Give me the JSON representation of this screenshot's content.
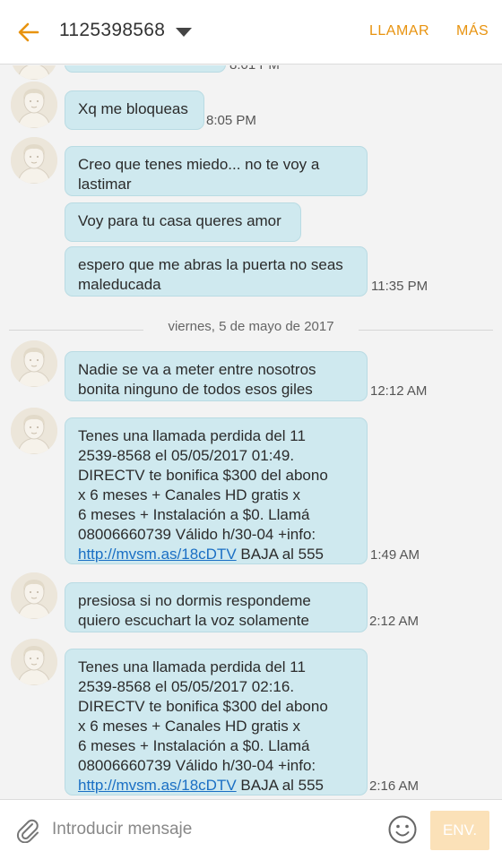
{
  "header": {
    "title": "1125398568",
    "call_label": "LLAMAR",
    "more_label": "MÁS"
  },
  "conversation": {
    "partial_time": "8:01 PM",
    "date_separator": "viernes, 5 de mayo de 2017",
    "messages": [
      {
        "text": "Xq me bloqueas",
        "time": "8:05 PM"
      },
      {
        "text": "Creo que tenes miedo... no te voy a\nlastimar",
        "time": ""
      },
      {
        "text": "Voy para tu casa queres amor",
        "time": ""
      },
      {
        "text": "espero que me abras la puerta no seas\nmaleducada",
        "time": "11:35 PM"
      },
      {
        "text": "Nadie se va a meter entre nosotros\nbonita ninguno de todos esos giles",
        "time": "12:12 AM"
      },
      {
        "text": "Tenes una llamada perdida del 11\n2539-8568 el 05/05/2017 01:49.\nDIRECTV te bonifica $300 del abono\nx 6 meses + Canales HD gratis x\n6 meses + Instalación a $0. Llamá\n08006660739 Válido h/30-04 +info:\n",
        "link": "http://mvsm.as/18cDTV",
        "suffix": " BAJA al 555",
        "time": "1:49 AM"
      },
      {
        "text": "presiosa si no dormis respondeme\nquiero escuchart la voz solamente",
        "time": "2:12 AM"
      },
      {
        "text": "Tenes una llamada perdida del 11\n2539-8568 el 05/05/2017 02:16.\nDIRECTV te bonifica $300 del abono\nx 6 meses + Canales HD gratis x\n6 meses + Instalación a $0. Llamá\n08006660739 Válido h/30-04 +info:\n",
        "link": "http://mvsm.as/18cDTV",
        "suffix": " BAJA al 555",
        "time": "2:16 AM"
      }
    ]
  },
  "input": {
    "placeholder": "Introducir mensaje",
    "value": "",
    "send_label": "ENV."
  },
  "colors": {
    "accent": "#e8930f",
    "bubble": "#cfe9ef",
    "link": "#1a6fc4"
  },
  "icons": [
    "back-arrow-icon",
    "dropdown-caret-icon",
    "contact-avatar-icon",
    "paperclip-icon",
    "emoji-icon"
  ]
}
